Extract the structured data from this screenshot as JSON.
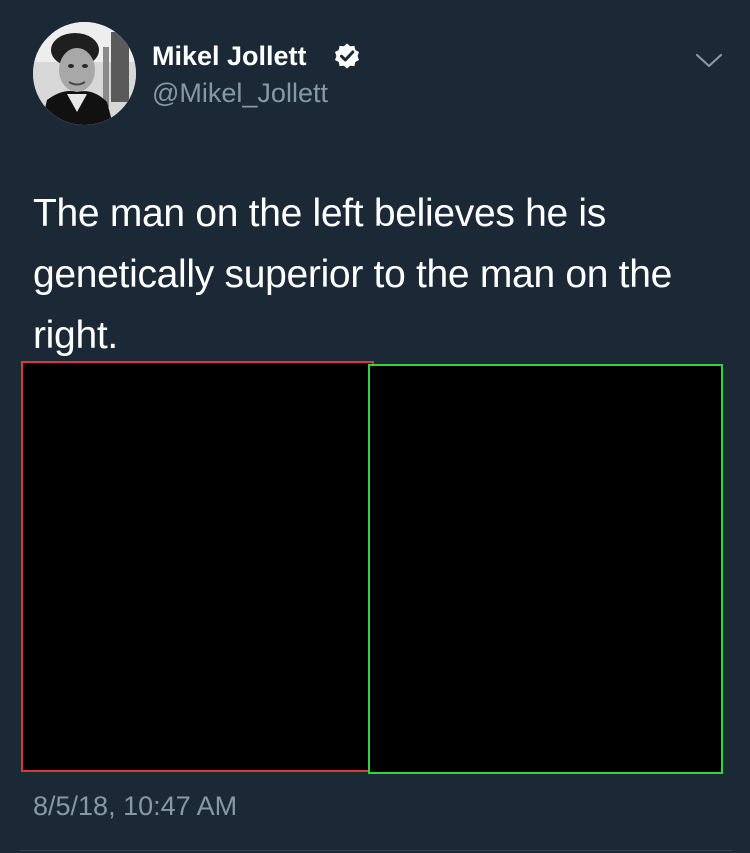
{
  "user": {
    "display_name": "Mikel Jollett",
    "handle": "@Mikel_Jollett",
    "verified": true
  },
  "tweet": {
    "text": "The man on the left believes he is genetically superior to the man on the right.",
    "timestamp": "8/5/18, 10:47 AM"
  },
  "images": {
    "left_border_color": "#e0343a",
    "right_border_color": "#2ed63d"
  },
  "icons": {
    "verified": "verified-badge-icon",
    "menu": "chevron-down-icon"
  },
  "colors": {
    "background": "#1b2836",
    "primary_text": "#ffffff",
    "secondary_text": "#8899a6"
  }
}
